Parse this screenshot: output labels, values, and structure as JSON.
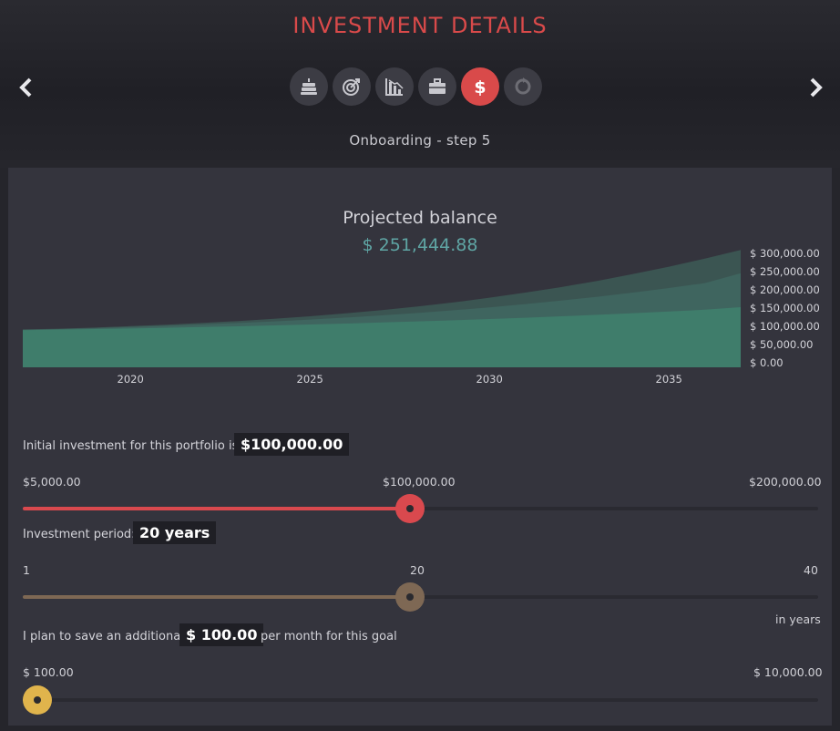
{
  "header": {
    "title": "INVESTMENT DETAILS",
    "subtitle": "Onboarding - step 5"
  },
  "steps": [
    {
      "icon": "cake-icon",
      "active": false
    },
    {
      "icon": "target-icon",
      "active": false
    },
    {
      "icon": "chart-down-icon",
      "active": false
    },
    {
      "icon": "briefcase-icon",
      "active": false
    },
    {
      "icon": "dollar-icon",
      "active": true
    },
    {
      "icon": "circle-arrows-icon",
      "active": false
    }
  ],
  "projection": {
    "label": "Projected balance",
    "value": "$ 251,444.88"
  },
  "chart_data": {
    "type": "area",
    "x": [
      2017,
      2018,
      2019,
      2020,
      2021,
      2022,
      2023,
      2024,
      2025,
      2026,
      2027,
      2028,
      2029,
      2030,
      2031,
      2032,
      2033,
      2034,
      2035,
      2036,
      2037
    ],
    "x_ticks": [
      "2020",
      "2025",
      "2030",
      "2035"
    ],
    "y_ticks": [
      "$ 300,000.00",
      "$ 250,000.00",
      "$ 200,000.00",
      "$ 150,000.00",
      "$ 100,000.00",
      "$ 50,000.00",
      "$ 0.00"
    ],
    "ylim": [
      0,
      320000
    ],
    "series": [
      {
        "values": [
          104000,
          106000,
          109000,
          113000,
          117000,
          122000,
          127000,
          133000,
          140000,
          148000,
          157000,
          167000,
          178000,
          191000,
          205000,
          220000,
          237000,
          256000,
          276000,
          298000,
          322000
        ]
      },
      {
        "values": [
          103000,
          105000,
          107500,
          110500,
          114000,
          117500,
          121500,
          126000,
          131000,
          136500,
          142500,
          149000,
          156500,
          164500,
          173500,
          183000,
          193500,
          205000,
          217500,
          231000,
          258000
        ]
      },
      {
        "values": [
          102000,
          103500,
          105000,
          106500,
          108500,
          110500,
          112500,
          115000,
          117500,
          120000,
          123000,
          126000,
          129000,
          132500,
          136000,
          140000,
          144000,
          148500,
          153000,
          158000,
          165000
        ]
      }
    ],
    "colors": [
      "#3b5552",
      "#3f655f",
      "#3f7d6b"
    ]
  },
  "initial_investment": {
    "label": "Initial investment for this portfolio is:",
    "value": "$100,000.00",
    "min_label": "$5,000.00",
    "mid_label": "$100,000.00",
    "max_label": "$200,000.00",
    "level": 0.4872,
    "color": "#d9494e"
  },
  "period": {
    "label": "Investment period:",
    "value": "20 years",
    "min_label": "1",
    "mid_label": "20",
    "max_label": "40",
    "unit_label": "in years",
    "level": 0.4872,
    "color": "#7e6854"
  },
  "monthly": {
    "label": "I plan to save an additional:",
    "value": "$ 100.00",
    "suffix": "per month for this goal",
    "min_label": "$ 100.00",
    "max_label": "$ 10,000.00",
    "level": 0.0,
    "color": "#e0b44c"
  }
}
